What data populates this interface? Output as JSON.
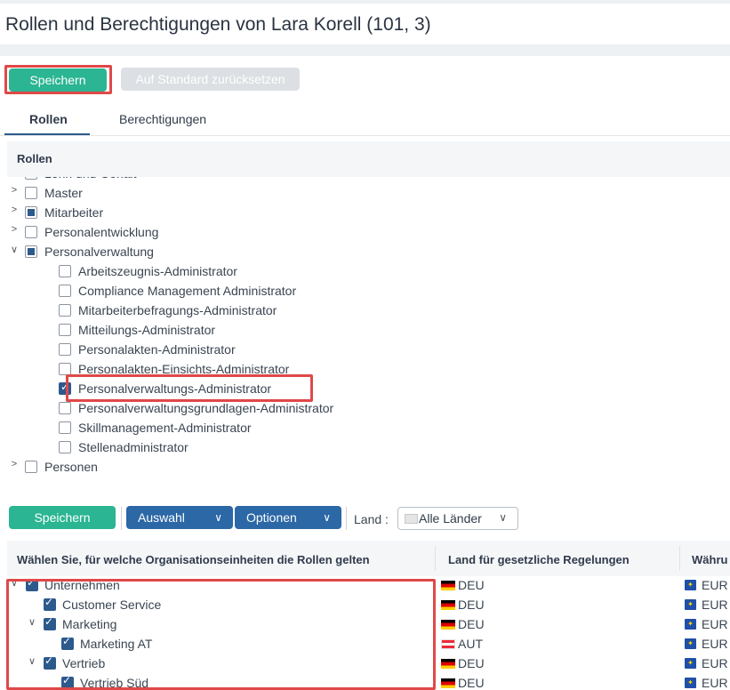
{
  "title": "Rollen und Berechtigungen von Lara Korell (101, 3)",
  "toolbar": {
    "save_label": "Speichern",
    "reset_label": "Auf Standard zurücksetzen"
  },
  "tabs": [
    {
      "label": "Rollen",
      "active": true
    },
    {
      "label": "Berechtigungen",
      "active": false
    }
  ],
  "roles": {
    "header": "Rollen",
    "items": [
      {
        "label": "Lohn und Gehalt",
        "level": 0,
        "expanded": false,
        "state": "unchecked"
      },
      {
        "label": "Master",
        "level": 0,
        "expanded": false,
        "state": "unchecked"
      },
      {
        "label": "Mitarbeiter",
        "level": 0,
        "expanded": false,
        "state": "partial"
      },
      {
        "label": "Personalentwicklung",
        "level": 0,
        "expanded": false,
        "state": "unchecked"
      },
      {
        "label": "Personalverwaltung",
        "level": 0,
        "expanded": true,
        "state": "partial"
      },
      {
        "label": "Arbeitszeugnis-Administrator",
        "level": 1,
        "state": "unchecked"
      },
      {
        "label": "Compliance Management Administrator",
        "level": 1,
        "state": "unchecked"
      },
      {
        "label": "Mitarbeiterbefragungs-Administrator",
        "level": 1,
        "state": "unchecked"
      },
      {
        "label": "Mitteilungs-Administrator",
        "level": 1,
        "state": "unchecked"
      },
      {
        "label": "Personalakten-Administrator",
        "level": 1,
        "state": "unchecked"
      },
      {
        "label": "Personalakten-Einsichts-Administrator",
        "level": 1,
        "state": "unchecked"
      },
      {
        "label": "Personalverwaltungs-Administrator",
        "level": 1,
        "state": "checked"
      },
      {
        "label": "Personalverwaltungsgrundlagen-Administrator",
        "level": 1,
        "state": "unchecked"
      },
      {
        "label": "Skillmanagement-Administrator",
        "level": 1,
        "state": "unchecked"
      },
      {
        "label": "Stellenadministrator",
        "level": 1,
        "state": "unchecked"
      },
      {
        "label": "Personen",
        "level": 0,
        "expanded": false,
        "state": "unchecked"
      }
    ]
  },
  "org_toolbar": {
    "save_label": "Speichern",
    "select_label": "Auswahl",
    "options_label": "Optionen",
    "country_label": "Land :",
    "country_value": "Alle Länder"
  },
  "org_table": {
    "columns": [
      "Wählen Sie, für welche Organisationseinheiten die Rollen gelten",
      "Land für gesetzliche Regelungen",
      "Währu"
    ],
    "rows": [
      {
        "label": "Unternehmen",
        "level": 0,
        "toggle": "expanded",
        "country": "DEU",
        "flag": "de",
        "currency": "EUR"
      },
      {
        "label": "Customer Service",
        "level": 1,
        "toggle": "none",
        "country": "DEU",
        "flag": "de",
        "currency": "EUR"
      },
      {
        "label": "Marketing",
        "level": 1,
        "toggle": "expanded",
        "country": "DEU",
        "flag": "de",
        "currency": "EUR"
      },
      {
        "label": "Marketing AT",
        "level": 2,
        "toggle": "none",
        "country": "AUT",
        "flag": "at",
        "currency": "EUR"
      },
      {
        "label": "Vertrieb",
        "level": 1,
        "toggle": "expanded",
        "country": "DEU",
        "flag": "de",
        "currency": "EUR"
      },
      {
        "label": "Vertrieb Süd",
        "level": 2,
        "toggle": "none",
        "country": "DEU",
        "flag": "de",
        "currency": "EUR"
      }
    ]
  },
  "colors": {
    "primary_green": "#2bb592",
    "primary_blue": "#2c67a6",
    "highlight_red": "#e04848",
    "checkbox_blue": "#2c5a8c"
  }
}
